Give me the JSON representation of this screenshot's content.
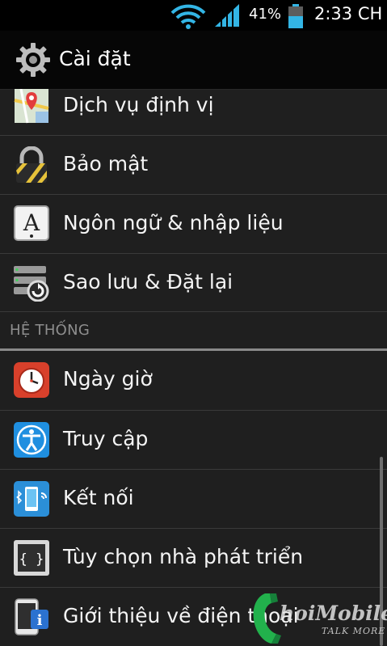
{
  "status_bar": {
    "battery_percent": "41%",
    "time": "2:33 CH",
    "icons": [
      "wifi-icon",
      "signal-icon",
      "battery-icon"
    ]
  },
  "action_bar": {
    "title": "Cài đặt",
    "icon": "settings-gear-icon"
  },
  "list": {
    "items_top": [
      {
        "label": "Dịch vụ định vị",
        "icon": "location-map-icon"
      },
      {
        "label": "Bảo mật",
        "icon": "padlock-icon"
      },
      {
        "label": "Ngôn ngữ & nhập liệu",
        "icon": "language-letter-icon"
      },
      {
        "label": "Sao lưu & Đặt lại",
        "icon": "backup-reset-icon"
      }
    ],
    "section_header": "HỆ THỐNG",
    "items_system": [
      {
        "label": "Ngày giờ",
        "icon": "alarm-clock-icon"
      },
      {
        "label": "Truy cập",
        "icon": "accessibility-icon"
      },
      {
        "label": "Kết nối",
        "icon": "connectivity-icon"
      },
      {
        "label": "Tùy chọn nhà phát triển",
        "icon": "developer-braces-icon"
      },
      {
        "label": "Giới thiệu về điện thoại",
        "icon": "phone-info-icon"
      }
    ]
  },
  "watermark": {
    "text": "hoiMobile",
    "tagline": "TALK MORE"
  },
  "colors": {
    "background": "#1f1f1f",
    "status_bar": "#000000",
    "divider": "#3a3a3a",
    "accent_blue": "#33b5e5"
  }
}
